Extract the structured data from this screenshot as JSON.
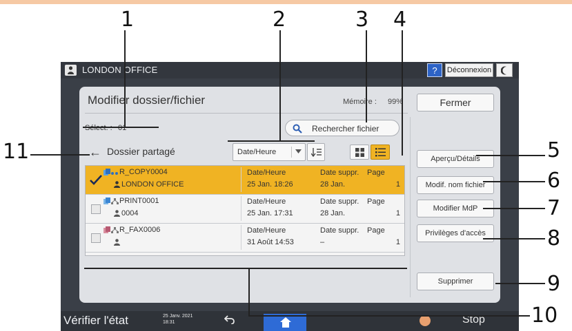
{
  "callouts": [
    "1",
    "2",
    "3",
    "4",
    "5",
    "6",
    "7",
    "8",
    "9",
    "10",
    "11"
  ],
  "header": {
    "office_name": "LONDON OFFICE",
    "help_label": "?",
    "logout_label": "Déconnexion"
  },
  "panel": {
    "title": "Modifier dossier/fichier",
    "memory_label": "Mémoire :",
    "memory_value": "99%",
    "close_label": "Fermer",
    "select_label": "Sélect. :",
    "select_count": "01",
    "search_label": "Rechercher fichier",
    "folder_name": "Dossier partagé",
    "sort_field": "Date/Heure"
  },
  "files": [
    {
      "name": "R_COPY0004",
      "owner": "LONDON OFFICE",
      "date_label": "Date/Heure",
      "date": "25 Jan.  18:26",
      "del_label": "Date suppr.",
      "del_date": "28 Jan.",
      "page_label": "Page",
      "pages": "1",
      "selected": true
    },
    {
      "name": "PRINT0001",
      "owner": "0004",
      "date_label": "Date/Heure",
      "date": "25 Jan.  17:31",
      "del_label": "Date suppr.",
      "del_date": "28 Jan.",
      "page_label": "Page",
      "pages": "1",
      "selected": false
    },
    {
      "name": "R_FAX0006",
      "owner": "",
      "date_label": "Date/Heure",
      "date": "31 Août  14:53",
      "del_label": "Date suppr.",
      "del_date": "–",
      "page_label": "Page",
      "pages": "1",
      "selected": false
    }
  ],
  "side_buttons": [
    "Aperçu/Détails",
    "Modif. nom fichier",
    "Modifier MdP",
    "Privilèges d'accès",
    "Supprimer"
  ],
  "bottom": {
    "check_status": "Vérifier l'état",
    "date_line1": "25 Janv. 2021",
    "date_line2": "18:31",
    "stop_label": "Stop"
  },
  "colors": {
    "accent_selected": "#f0b323",
    "home_blue": "#2e6bd6",
    "screen_bg": "#3a3f47"
  }
}
